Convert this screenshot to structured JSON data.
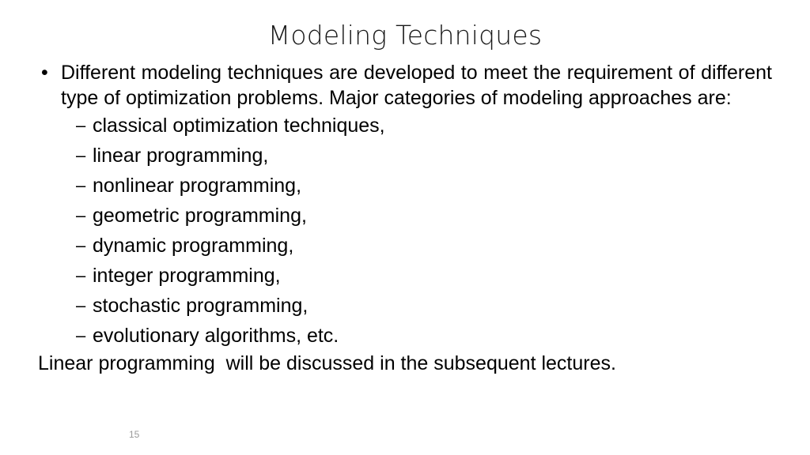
{
  "slide": {
    "title": "Modeling Techniques",
    "page_number": "15",
    "background_color": "#ffffff",
    "text_color": "#000000",
    "page_number_color": "#9a9a9a"
  },
  "content": {
    "main_bullet": {
      "marker": "•",
      "text": "Different modeling techniques are developed to meet the requirement of different type of optimization problems. Major categories of modeling approaches are:"
    },
    "sub_bullets": {
      "marker": "–",
      "items": [
        "classical optimization techniques,",
        "linear programming,",
        "nonlinear programming,",
        "geometric programming,",
        "dynamic programming,",
        "integer programming,",
        "stochastic programming,",
        "evolutionary algorithms, etc."
      ]
    },
    "closing_paragraph": "Linear programming  will be discussed in the subsequent lectures."
  }
}
